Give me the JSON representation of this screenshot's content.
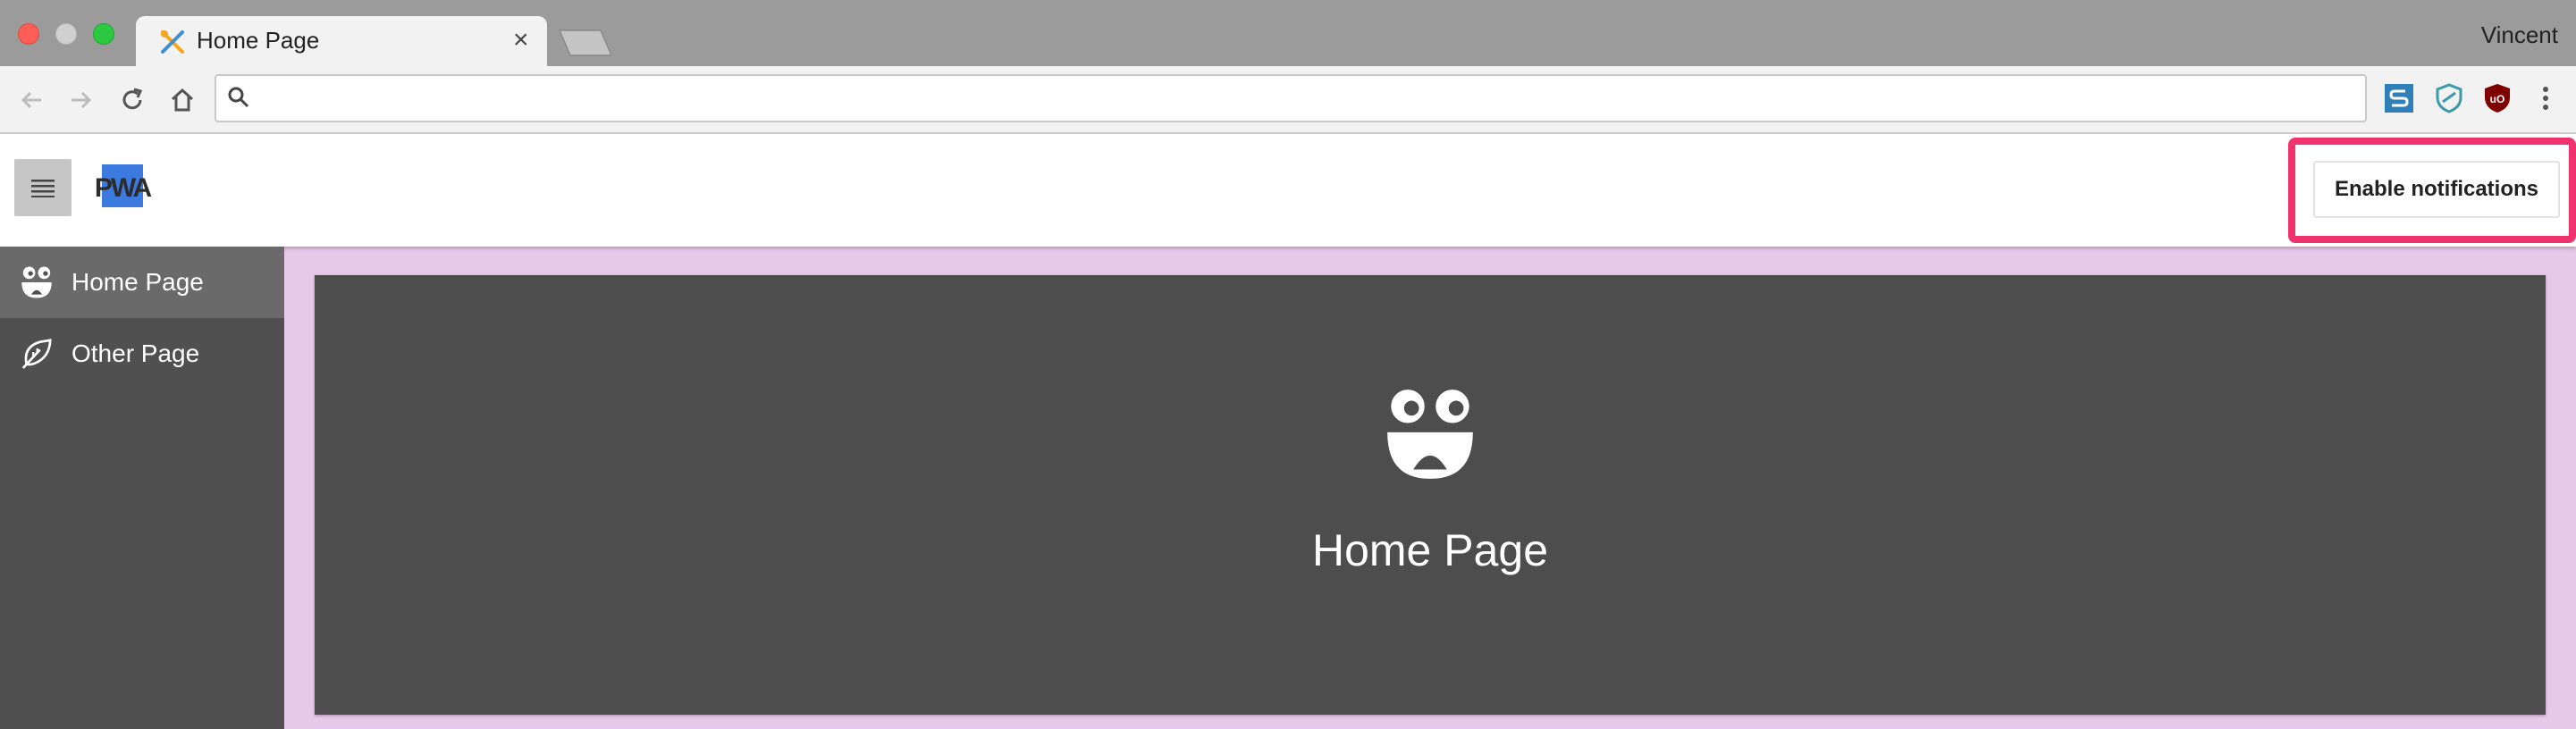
{
  "browser": {
    "tab_title": "Home Page",
    "tab_close": "×",
    "user_name": "Vincent",
    "address_value": "",
    "extensions": [
      "s-extension-icon",
      "shield-extension-icon",
      "ublock-extension-icon",
      "more-menu-icon"
    ]
  },
  "app": {
    "logo_text": "PWA",
    "notify_label": "Enable notifications",
    "accent_color": "#f0326e",
    "nav": [
      {
        "label": "Home Page",
        "icon": "smiley-icon",
        "active": true
      },
      {
        "label": "Other Page",
        "icon": "leaf-icon",
        "active": false
      }
    ],
    "card_title": "Home Page",
    "card_icon": "smiley-icon"
  }
}
